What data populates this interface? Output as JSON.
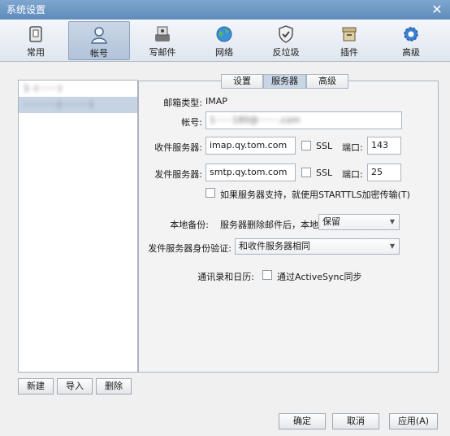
{
  "window": {
    "title": "系统设置"
  },
  "toolbar": {
    "items": [
      {
        "label": "常用",
        "icon": "settings-icon"
      },
      {
        "label": "帐号",
        "icon": "user-icon"
      },
      {
        "label": "写邮件",
        "icon": "compose-icon"
      },
      {
        "label": "网络",
        "icon": "globe-icon"
      },
      {
        "label": "反垃圾",
        "icon": "shield-icon"
      },
      {
        "label": "插件",
        "icon": "plugin-box-icon"
      },
      {
        "label": "高级",
        "icon": "gear-icon"
      }
    ],
    "active_index": 1
  },
  "accounts": {
    "items": [
      {
        "label": "1··(·······)"
      },
      {
        "label": "············(··········)"
      }
    ],
    "selected_index": 1,
    "buttons": {
      "new": "新建",
      "import": "导入",
      "delete": "删除"
    }
  },
  "tabs": {
    "items": [
      "设置",
      "服务器",
      "高级"
    ],
    "active_index": 1
  },
  "server": {
    "mail_type_label": "邮箱类型:",
    "mail_type_value": "IMAP",
    "account_label": "帐号:",
    "account_value": "1······180@·······.com",
    "incoming_label": "收件服务器:",
    "incoming_value": "imap.qy.tom.com",
    "incoming_ssl_label": "SSL",
    "incoming_port_label": "端口:",
    "incoming_port_value": "143",
    "outgoing_label": "发件服务器:",
    "outgoing_value": "smtp.qy.tom.com",
    "outgoing_ssl_label": "SSL",
    "outgoing_port_label": "端口:",
    "outgoing_port_value": "25",
    "starttls_label": "如果服务器支持，就使用STARTTLS加密传输(T)",
    "backup_label": "本地备份:",
    "backup_desc": "服务器删除邮件后，本地",
    "backup_value": "保留",
    "smtp_auth_label": "发件服务器身份验证:",
    "smtp_auth_value": "和收件服务器相同",
    "contacts_label": "通讯录和日历:",
    "activesync_label": "通过ActiveSync同步"
  },
  "footer": {
    "ok": "确定",
    "cancel": "取消",
    "apply": "应用(A)"
  },
  "colors": {
    "titlebar": "#6b95c3",
    "accent": "#c6d3e3",
    "border": "#a9b4c2"
  }
}
